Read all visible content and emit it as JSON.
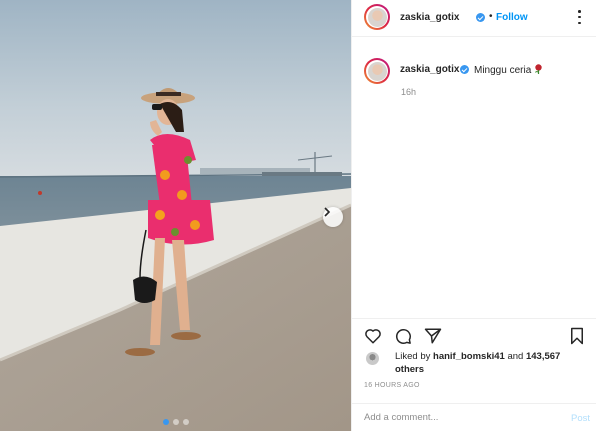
{
  "header": {
    "username": "zaskia_gotix",
    "separator": "•",
    "follow_label": "Follow"
  },
  "comment": {
    "username": "zaskia_gotix",
    "caption": "Minggu ceria",
    "age": "16h"
  },
  "likes": {
    "prefix": "Liked by ",
    "first_liker": "hanif_bomski41",
    "conjunction": " and ",
    "others": "143,567 others"
  },
  "timestamp": "16 HOURS AGO",
  "add_comment": {
    "placeholder": "Add a comment...",
    "post_label": "Post"
  },
  "icons": {
    "like": "heart-icon",
    "comment": "comment-icon",
    "share": "paper-plane-icon",
    "save": "bookmark-icon",
    "next": "chevron-right-icon",
    "more": "more-options-icon",
    "verified": "verified-badge-icon",
    "caption_emoji": "rose-icon"
  },
  "colors": {
    "accent": "#0095f6",
    "verified": "#3897f0",
    "muted": "#8e8e8e",
    "post_disabled": "#b2dffc",
    "dress": "#ea2e6e"
  }
}
